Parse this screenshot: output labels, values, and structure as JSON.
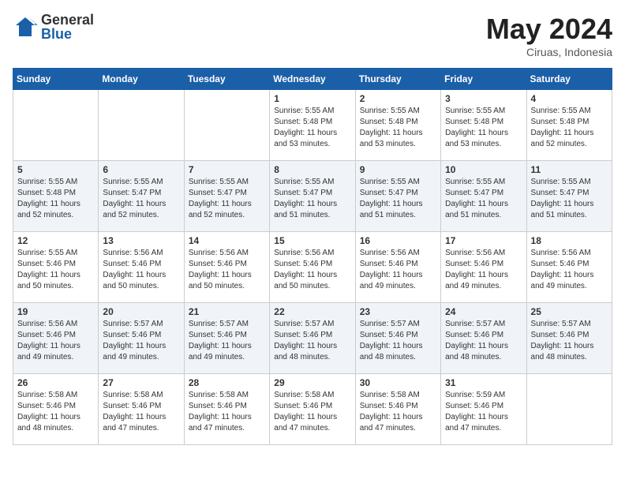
{
  "header": {
    "logo_general": "General",
    "logo_blue": "Blue",
    "title": "May 2024",
    "location": "Ciruas, Indonesia"
  },
  "weekdays": [
    "Sunday",
    "Monday",
    "Tuesday",
    "Wednesday",
    "Thursday",
    "Friday",
    "Saturday"
  ],
  "weeks": [
    [
      {
        "day": "",
        "info": ""
      },
      {
        "day": "",
        "info": ""
      },
      {
        "day": "",
        "info": ""
      },
      {
        "day": "1",
        "info": "Sunrise: 5:55 AM\nSunset: 5:48 PM\nDaylight: 11 hours\nand 53 minutes."
      },
      {
        "day": "2",
        "info": "Sunrise: 5:55 AM\nSunset: 5:48 PM\nDaylight: 11 hours\nand 53 minutes."
      },
      {
        "day": "3",
        "info": "Sunrise: 5:55 AM\nSunset: 5:48 PM\nDaylight: 11 hours\nand 53 minutes."
      },
      {
        "day": "4",
        "info": "Sunrise: 5:55 AM\nSunset: 5:48 PM\nDaylight: 11 hours\nand 52 minutes."
      }
    ],
    [
      {
        "day": "5",
        "info": "Sunrise: 5:55 AM\nSunset: 5:48 PM\nDaylight: 11 hours\nand 52 minutes."
      },
      {
        "day": "6",
        "info": "Sunrise: 5:55 AM\nSunset: 5:47 PM\nDaylight: 11 hours\nand 52 minutes."
      },
      {
        "day": "7",
        "info": "Sunrise: 5:55 AM\nSunset: 5:47 PM\nDaylight: 11 hours\nand 52 minutes."
      },
      {
        "day": "8",
        "info": "Sunrise: 5:55 AM\nSunset: 5:47 PM\nDaylight: 11 hours\nand 51 minutes."
      },
      {
        "day": "9",
        "info": "Sunrise: 5:55 AM\nSunset: 5:47 PM\nDaylight: 11 hours\nand 51 minutes."
      },
      {
        "day": "10",
        "info": "Sunrise: 5:55 AM\nSunset: 5:47 PM\nDaylight: 11 hours\nand 51 minutes."
      },
      {
        "day": "11",
        "info": "Sunrise: 5:55 AM\nSunset: 5:47 PM\nDaylight: 11 hours\nand 51 minutes."
      }
    ],
    [
      {
        "day": "12",
        "info": "Sunrise: 5:55 AM\nSunset: 5:46 PM\nDaylight: 11 hours\nand 50 minutes."
      },
      {
        "day": "13",
        "info": "Sunrise: 5:56 AM\nSunset: 5:46 PM\nDaylight: 11 hours\nand 50 minutes."
      },
      {
        "day": "14",
        "info": "Sunrise: 5:56 AM\nSunset: 5:46 PM\nDaylight: 11 hours\nand 50 minutes."
      },
      {
        "day": "15",
        "info": "Sunrise: 5:56 AM\nSunset: 5:46 PM\nDaylight: 11 hours\nand 50 minutes."
      },
      {
        "day": "16",
        "info": "Sunrise: 5:56 AM\nSunset: 5:46 PM\nDaylight: 11 hours\nand 49 minutes."
      },
      {
        "day": "17",
        "info": "Sunrise: 5:56 AM\nSunset: 5:46 PM\nDaylight: 11 hours\nand 49 minutes."
      },
      {
        "day": "18",
        "info": "Sunrise: 5:56 AM\nSunset: 5:46 PM\nDaylight: 11 hours\nand 49 minutes."
      }
    ],
    [
      {
        "day": "19",
        "info": "Sunrise: 5:56 AM\nSunset: 5:46 PM\nDaylight: 11 hours\nand 49 minutes."
      },
      {
        "day": "20",
        "info": "Sunrise: 5:57 AM\nSunset: 5:46 PM\nDaylight: 11 hours\nand 49 minutes."
      },
      {
        "day": "21",
        "info": "Sunrise: 5:57 AM\nSunset: 5:46 PM\nDaylight: 11 hours\nand 49 minutes."
      },
      {
        "day": "22",
        "info": "Sunrise: 5:57 AM\nSunset: 5:46 PM\nDaylight: 11 hours\nand 48 minutes."
      },
      {
        "day": "23",
        "info": "Sunrise: 5:57 AM\nSunset: 5:46 PM\nDaylight: 11 hours\nand 48 minutes."
      },
      {
        "day": "24",
        "info": "Sunrise: 5:57 AM\nSunset: 5:46 PM\nDaylight: 11 hours\nand 48 minutes."
      },
      {
        "day": "25",
        "info": "Sunrise: 5:57 AM\nSunset: 5:46 PM\nDaylight: 11 hours\nand 48 minutes."
      }
    ],
    [
      {
        "day": "26",
        "info": "Sunrise: 5:58 AM\nSunset: 5:46 PM\nDaylight: 11 hours\nand 48 minutes."
      },
      {
        "day": "27",
        "info": "Sunrise: 5:58 AM\nSunset: 5:46 PM\nDaylight: 11 hours\nand 47 minutes."
      },
      {
        "day": "28",
        "info": "Sunrise: 5:58 AM\nSunset: 5:46 PM\nDaylight: 11 hours\nand 47 minutes."
      },
      {
        "day": "29",
        "info": "Sunrise: 5:58 AM\nSunset: 5:46 PM\nDaylight: 11 hours\nand 47 minutes."
      },
      {
        "day": "30",
        "info": "Sunrise: 5:58 AM\nSunset: 5:46 PM\nDaylight: 11 hours\nand 47 minutes."
      },
      {
        "day": "31",
        "info": "Sunrise: 5:59 AM\nSunset: 5:46 PM\nDaylight: 11 hours\nand 47 minutes."
      },
      {
        "day": "",
        "info": ""
      }
    ]
  ]
}
